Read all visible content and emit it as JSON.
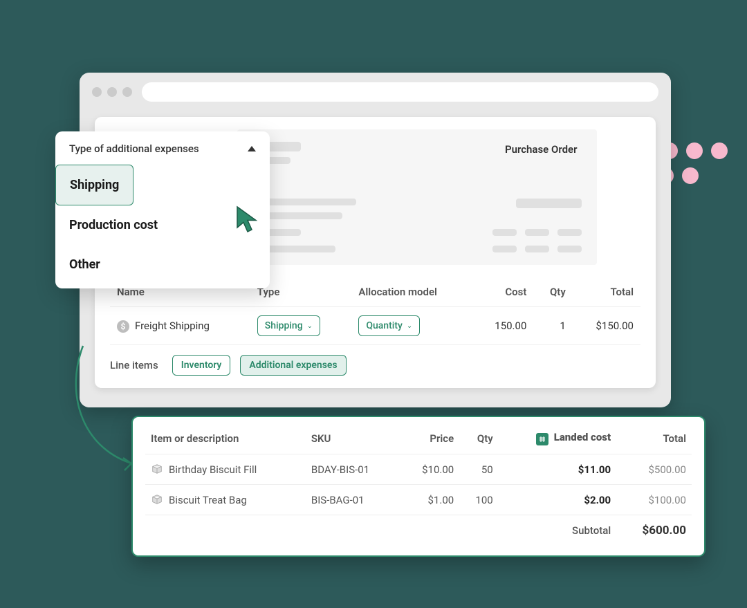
{
  "dropdown": {
    "header": "Type of additional expenses",
    "items": [
      "Shipping",
      "Production cost",
      "Other"
    ]
  },
  "po": {
    "title": "Purchase Order"
  },
  "expense_table": {
    "headers": {
      "name": "Name",
      "type": "Type",
      "alloc": "Allocation model",
      "cost": "Cost",
      "qty": "Qty",
      "total": "Total"
    },
    "row": {
      "name": "Freight Shipping",
      "type": "Shipping",
      "alloc": "Quantity",
      "cost": "150.00",
      "qty": "1",
      "total": "$150.00"
    }
  },
  "lineitems": {
    "label": "Line items",
    "tabs": {
      "inventory": "Inventory",
      "additional": "Additional expenses"
    }
  },
  "items": {
    "headers": {
      "desc": "Item or description",
      "sku": "SKU",
      "price": "Price",
      "qty": "Qty",
      "landed": "Landed cost",
      "total": "Total"
    },
    "rows": [
      {
        "desc": "Birthday Biscuit Fill",
        "sku": "BDAY-BIS-01",
        "price": "$10.00",
        "qty": "50",
        "landed": "$11.00",
        "total": "$500.00"
      },
      {
        "desc": "Biscuit Treat Bag",
        "sku": "BIS-BAG-01",
        "price": "$1.00",
        "qty": "100",
        "landed": "$2.00",
        "total": "$100.00"
      }
    ],
    "subtotal_label": "Subtotal",
    "subtotal": "$600.00"
  }
}
